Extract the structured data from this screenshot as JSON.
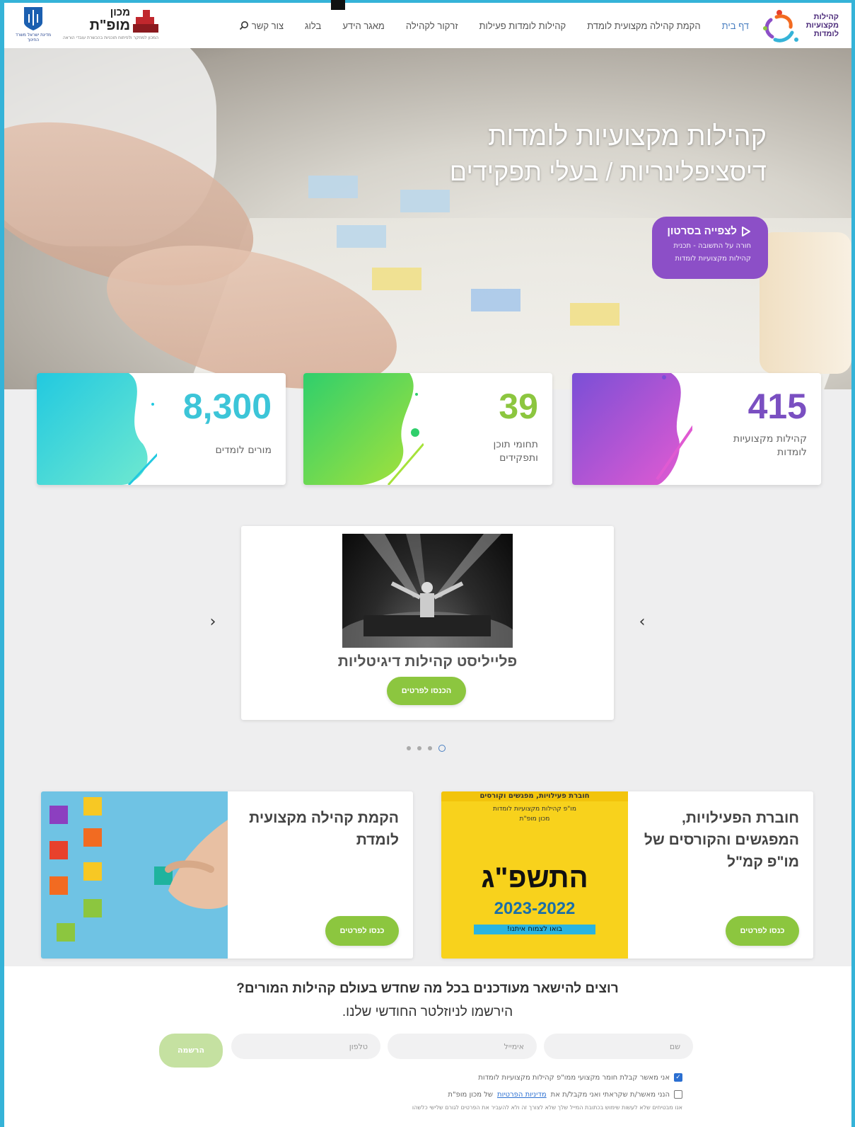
{
  "header": {
    "brand_lines": [
      "קהילות",
      "מקצועיות",
      "לומדות"
    ],
    "nav": [
      {
        "label": "דף בית",
        "active": true
      },
      {
        "label": "הקמת קהילה מקצועית לומדת"
      },
      {
        "label": "קהילות לומדות פעילות"
      },
      {
        "label": "זרקור לקהילה"
      },
      {
        "label": "מאגר הידע"
      },
      {
        "label": "בלוג"
      },
      {
        "label": "צור קשר"
      }
    ],
    "mofet_small": "מכון",
    "mofet_big": "מופ\"ת",
    "mofet_sub": "המכון למחקר ולפיתוח תוכניות בהכשרת עובדי הוראה",
    "gov_text": "מדינת ישראל משרד החינוך"
  },
  "hero": {
    "line1": "קהילות מקצועיות לומדות",
    "line2": "דיסציפלינריות / בעלי תפקידים",
    "btn_main": "לצפייה בסרטון",
    "btn_sub_1": "חורה על התשובה - תכנית",
    "btn_sub_2": "קהילות מקצועיות לומדות"
  },
  "stats": [
    {
      "number": "415",
      "label": "קהילות מקצועיות לומדות",
      "color": "#7a4fc1"
    },
    {
      "number": "39",
      "label": "תחומי תוכן ותפקידים",
      "color": "#8cc63f"
    },
    {
      "number": "8,300",
      "label": "מורים לומדים",
      "color": "#3cc5d8"
    }
  ],
  "slider": {
    "title": "פלייליסט קהילות דיגיטליות",
    "button": "הכנסו לפרטים",
    "prev": "‹",
    "next": "›"
  },
  "cards": [
    {
      "title": "חוברת הפעילויות, המפגשים והקורסים של מו\"פ קמ\"ל",
      "button": "כנסו לפרטים",
      "img_header": "חוברת פעילויות, מפגשים וקורסים",
      "img_sub1": "מו\"פ קהילות מקצועיות לומדות",
      "img_sub2": "מכון מופ\"ת",
      "img_year_heb": "התשפ\"ג",
      "img_year": "2023-2022",
      "img_banner": "בואו לצמוח איתנו!"
    },
    {
      "title": "הקמת קהילה מקצועית לומדת",
      "button": "כנסו לפרטים"
    }
  ],
  "newsletter": {
    "title": "רוצים להישאר מעודכנים בכל מה שחדש בעולם קהילות המורים?",
    "subtitle": "הירשמו לניוזלטר החודשי שלנו.",
    "name_placeholder": "שם",
    "email_placeholder": "אימייל",
    "phone_placeholder": "טלפון",
    "submit": "הרשמה",
    "check1": "אני מאשר קבלת חומר מקצועי ממו\"פ קהילות מקצועיות לומדות",
    "check2_pre": "הנני מאשר/ת שקראתי ואני מקבל/ת את",
    "check2_link": "מדיניות הפרטיות",
    "check2_post": "של מכון מופ\"ת",
    "note": "אנו מבטיחים שלא לעשות שימוש בכתובת המייל שלך שלא לצורך זה ולא להעביר את הפרטים לגורם שלישי כלשהו"
  }
}
